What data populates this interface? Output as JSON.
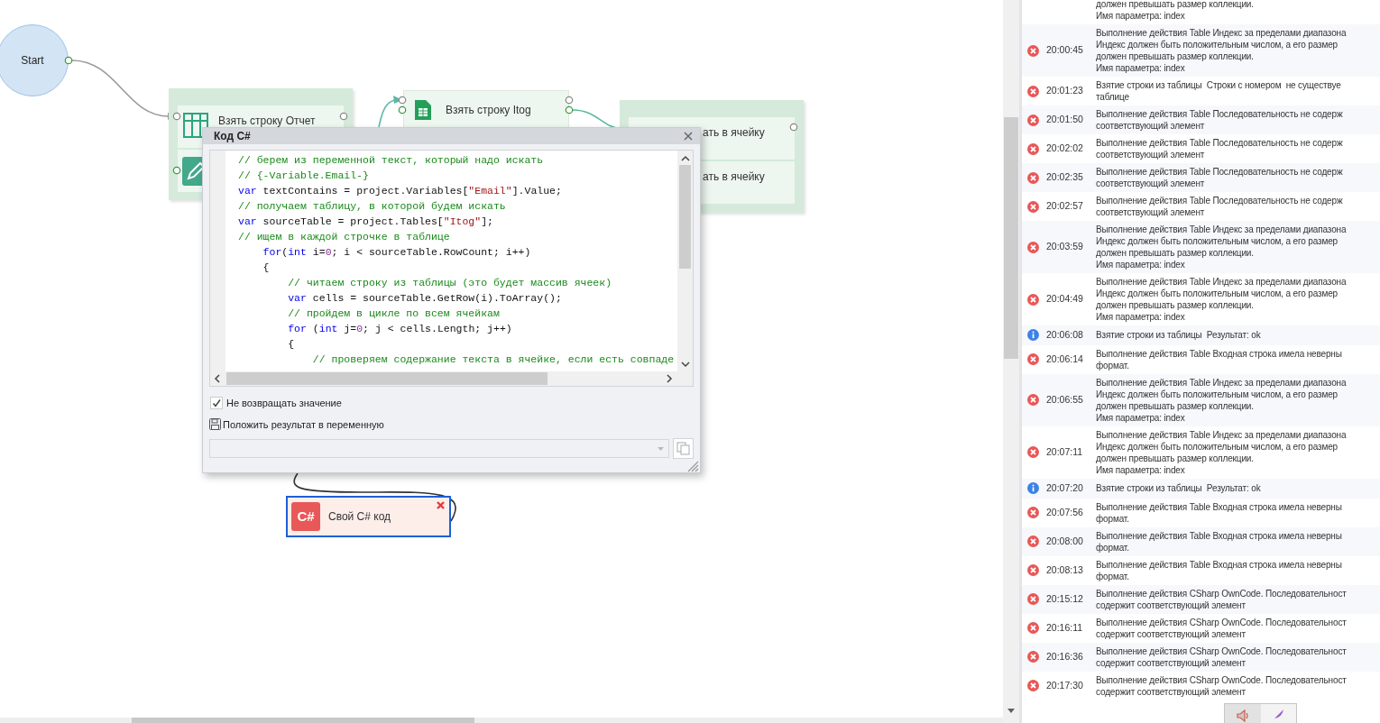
{
  "canvas": {
    "start_node": {
      "label": "Start"
    },
    "blocks": [
      {
        "kind": "group",
        "selected": false,
        "items": [
          {
            "kind": "table",
            "label": "Взять строку Отчет"
          },
          {
            "kind": "edit"
          }
        ]
      },
      {
        "kind": "single",
        "selected": false,
        "items": [
          {
            "kind": "sheet",
            "label": "Взять строку Itog"
          }
        ]
      },
      {
        "kind": "group",
        "selected": false,
        "items": [
          {
            "kind": "plain",
            "label": "ать в ячейку"
          },
          {
            "kind": "plain",
            "label": "ать в ячейку"
          }
        ]
      },
      {
        "kind": "single",
        "selected": true,
        "items": [
          {
            "kind": "csharp",
            "icon_text": "C#",
            "label": "Свой C# код"
          }
        ]
      }
    ]
  },
  "dialog": {
    "title": "Код C#",
    "code_lines": [
      [
        {
          "text": "// берем из переменной текст, который надо искать",
          "kind": "comment"
        }
      ],
      [
        {
          "text": "// {-Variable.Email-}",
          "kind": "comment"
        }
      ],
      [
        {
          "text": "var",
          "kind": "keyword"
        },
        {
          "text": " textContains = project.Variables[",
          "kind": "plain"
        },
        {
          "text": "\"Email\"",
          "kind": "string"
        },
        {
          "text": "].Value;",
          "kind": "plain"
        }
      ],
      [
        {
          "text": "// получаем таблицу, в которой будем искать",
          "kind": "comment"
        }
      ],
      [
        {
          "text": "var",
          "kind": "keyword"
        },
        {
          "text": " sourceTable = project.Tables[",
          "kind": "plain"
        },
        {
          "text": "\"Itog\"",
          "kind": "string"
        },
        {
          "text": "];",
          "kind": "plain"
        }
      ],
      [
        {
          "text": "// ищем в каждой строчке в таблице",
          "kind": "comment"
        }
      ],
      [
        {
          "text": "    for",
          "kind": "keyword"
        },
        {
          "text": "(",
          "kind": "plain"
        },
        {
          "text": "int",
          "kind": "keyword"
        },
        {
          "text": " i=",
          "kind": "plain"
        },
        {
          "text": "0",
          "kind": "number"
        },
        {
          "text": "; i < sourceTable.RowCount; i++)",
          "kind": "plain"
        }
      ],
      [
        {
          "text": "    {",
          "kind": "plain"
        }
      ],
      [
        {
          "text": "        // читаем строку из таблицы (это будет массив ячеек)",
          "kind": "comment"
        }
      ],
      [
        {
          "text": "        var",
          "kind": "keyword"
        },
        {
          "text": " cells = sourceTable.GetRow(i).ToArray();",
          "kind": "plain"
        }
      ],
      [
        {
          "text": "        // пройдем в цикле по всем ячейкам",
          "kind": "comment"
        }
      ],
      [
        {
          "text": "        for",
          "kind": "keyword"
        },
        {
          "text": " (",
          "kind": "plain"
        },
        {
          "text": "int",
          "kind": "keyword"
        },
        {
          "text": " j=",
          "kind": "plain"
        },
        {
          "text": "0",
          "kind": "number"
        },
        {
          "text": "; j < cells.Length; j++)",
          "kind": "plain"
        }
      ],
      [
        {
          "text": "        {",
          "kind": "plain"
        }
      ],
      [
        {
          "text": "            // проверяем содержание текста в ячейке, если есть совпаде",
          "kind": "comment"
        }
      ]
    ],
    "options": [
      {
        "kind": "checkbox",
        "label": "Не возвращать значение",
        "checked": true
      },
      {
        "kind": "save",
        "label": "Положить результат в переменную"
      }
    ],
    "variable_select": {
      "disabled": true
    }
  },
  "log": {
    "entries": [
      {
        "lines": [
          "должен превышать размер коллекции.",
          "Имя параметра: index"
        ]
      },
      {
        "kind": "error",
        "time": "20:00:45",
        "lines": [
          "Выполнение действия Table Индекс за пределами диапазона",
          "Индекс должен быть положительным числом, а его размер",
          "должен превышать размер коллекции.",
          "Имя параметра: index"
        ]
      },
      {
        "kind": "error",
        "time": "20:01:23",
        "lines": [
          "Взятие строки из таблицы  Строки с номером  не существуе",
          "таблице"
        ]
      },
      {
        "kind": "error",
        "time": "20:01:50",
        "lines": [
          "Выполнение действия Table Последовательность не содерж",
          "соответствующий элемент"
        ]
      },
      {
        "kind": "error",
        "time": "20:02:02",
        "lines": [
          "Выполнение действия Table Последовательность не содерж",
          "соответствующий элемент"
        ]
      },
      {
        "kind": "error",
        "time": "20:02:35",
        "lines": [
          "Выполнение действия Table Последовательность не содерж",
          "соответствующий элемент"
        ]
      },
      {
        "kind": "error",
        "time": "20:02:57",
        "lines": [
          "Выполнение действия Table Последовательность не содерж",
          "соответствующий элемент"
        ]
      },
      {
        "kind": "error",
        "time": "20:03:59",
        "lines": [
          "Выполнение действия Table Индекс за пределами диапазона",
          "Индекс должен быть положительным числом, а его размер",
          "должен превышать размер коллекции.",
          "Имя параметра: index"
        ]
      },
      {
        "kind": "error",
        "time": "20:04:49",
        "lines": [
          "Выполнение действия Table Индекс за пределами диапазона",
          "Индекс должен быть положительным числом, а его размер",
          "должен превышать размер коллекции.",
          "Имя параметра: index"
        ]
      },
      {
        "kind": "info",
        "time": "20:06:08",
        "lines": [
          "Взятие строки из таблицы  Результат: ok"
        ]
      },
      {
        "kind": "error",
        "time": "20:06:14",
        "lines": [
          "Выполнение действия Table Входная строка имела неверны",
          "формат."
        ]
      },
      {
        "kind": "error",
        "time": "20:06:55",
        "lines": [
          "Выполнение действия Table Индекс за пределами диапазона",
          "Индекс должен быть положительным числом, а его размер",
          "должен превышать размер коллекции.",
          "Имя параметра: index"
        ]
      },
      {
        "kind": "error",
        "time": "20:07:11",
        "lines": [
          "Выполнение действия Table Индекс за пределами диапазона",
          "Индекс должен быть положительным числом, а его размер",
          "должен превышать размер коллекции.",
          "Имя параметра: index"
        ]
      },
      {
        "kind": "info",
        "time": "20:07:20",
        "lines": [
          "Взятие строки из таблицы  Результат: ok"
        ]
      },
      {
        "kind": "error",
        "time": "20:07:56",
        "lines": [
          "Выполнение действия Table Входная строка имела неверны",
          "формат."
        ]
      },
      {
        "kind": "error",
        "time": "20:08:00",
        "lines": [
          "Выполнение действия Table Входная строка имела неверны",
          "формат."
        ]
      },
      {
        "kind": "error",
        "time": "20:08:13",
        "lines": [
          "Выполнение действия Table Входная строка имела неверны",
          "формат."
        ]
      },
      {
        "kind": "error",
        "time": "20:15:12",
        "lines": [
          "Выполнение действия CSharp OwnCode. Последовательност",
          "содержит соответствующий элемент"
        ]
      },
      {
        "kind": "error",
        "time": "20:16:11",
        "lines": [
          "Выполнение действия CSharp OwnCode. Последовательност",
          "содержит соответствующий элемент"
        ]
      },
      {
        "kind": "error",
        "time": "20:16:36",
        "lines": [
          "Выполнение действия CSharp OwnCode. Последовательност",
          "содержит соответствующий элемент"
        ]
      },
      {
        "kind": "error",
        "time": "20:17:30",
        "lines": [
          "Выполнение действия CSharp OwnCode. Последовательност",
          "содержит соответствующий элемент"
        ]
      }
    ]
  }
}
